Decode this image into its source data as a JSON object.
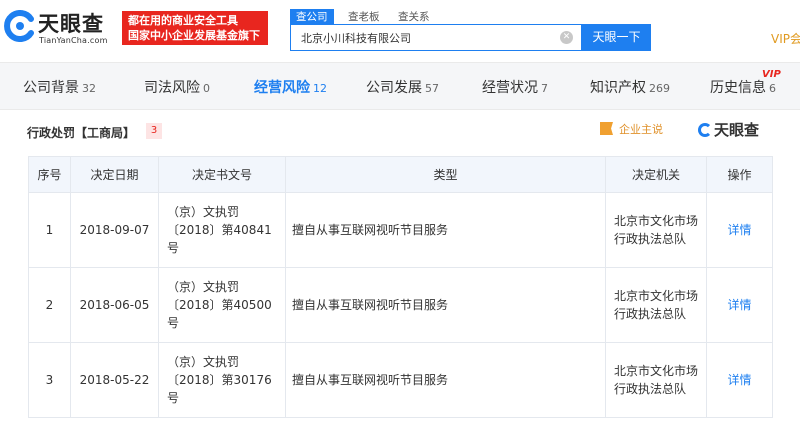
{
  "header": {
    "logo_cn": "天眼查",
    "logo_en": "TianYanCha.com",
    "slogan_line1": "都在用的商业安全工具",
    "slogan_line2": "国家中小企业发展基金旗下",
    "search_tabs": [
      "查公司",
      "查老板",
      "查关系"
    ],
    "search_value": "北京小川科技有限公司",
    "search_button": "天眼一下",
    "vip_link": "VIP会"
  },
  "nav": {
    "items": [
      {
        "label": "公司背景",
        "count": "32"
      },
      {
        "label": "司法风险",
        "count": "0"
      },
      {
        "label": "经营风险",
        "count": "12"
      },
      {
        "label": "公司发展",
        "count": "57"
      },
      {
        "label": "经营状况",
        "count": "7"
      },
      {
        "label": "知识产权",
        "count": "269"
      },
      {
        "label": "历史信息",
        "count": "6"
      }
    ],
    "vip_badge": "VIP"
  },
  "section": {
    "title": "行政处罚【工商局】",
    "count": "3",
    "owner_button": "企业主说",
    "brand": "天眼查"
  },
  "table": {
    "headers": [
      "序号",
      "决定日期",
      "决定书文号",
      "类型",
      "决定机关",
      "操作"
    ],
    "rows": [
      {
        "index": "1",
        "date": "2018-09-07",
        "doc_line1": "（京）文执罚",
        "doc_line2": "〔2018〕第40841",
        "doc_line3": "号",
        "type": "擅自从事互联网视听节目服务",
        "org_line1": "北京市文化市场",
        "org_line2": "行政执法总队",
        "action": "详情"
      },
      {
        "index": "2",
        "date": "2018-06-05",
        "doc_line1": "（京）文执罚",
        "doc_line2": "〔2018〕第40500",
        "doc_line3": "号",
        "type": "擅自从事互联网视听节目服务",
        "org_line1": "北京市文化市场",
        "org_line2": "行政执法总队",
        "action": "详情"
      },
      {
        "index": "3",
        "date": "2018-05-22",
        "doc_line1": "（京）文执罚",
        "doc_line2": "〔2018〕第30176",
        "doc_line3": "号",
        "type": "擅自从事互联网视听节目服务",
        "org_line1": "北京市文化市场",
        "org_line2": "行政执法总队",
        "action": "详情"
      }
    ]
  },
  "colors": {
    "accent": "#1e7ff0",
    "brand_red": "#e8261f",
    "owner_orange": "#e0912a"
  }
}
